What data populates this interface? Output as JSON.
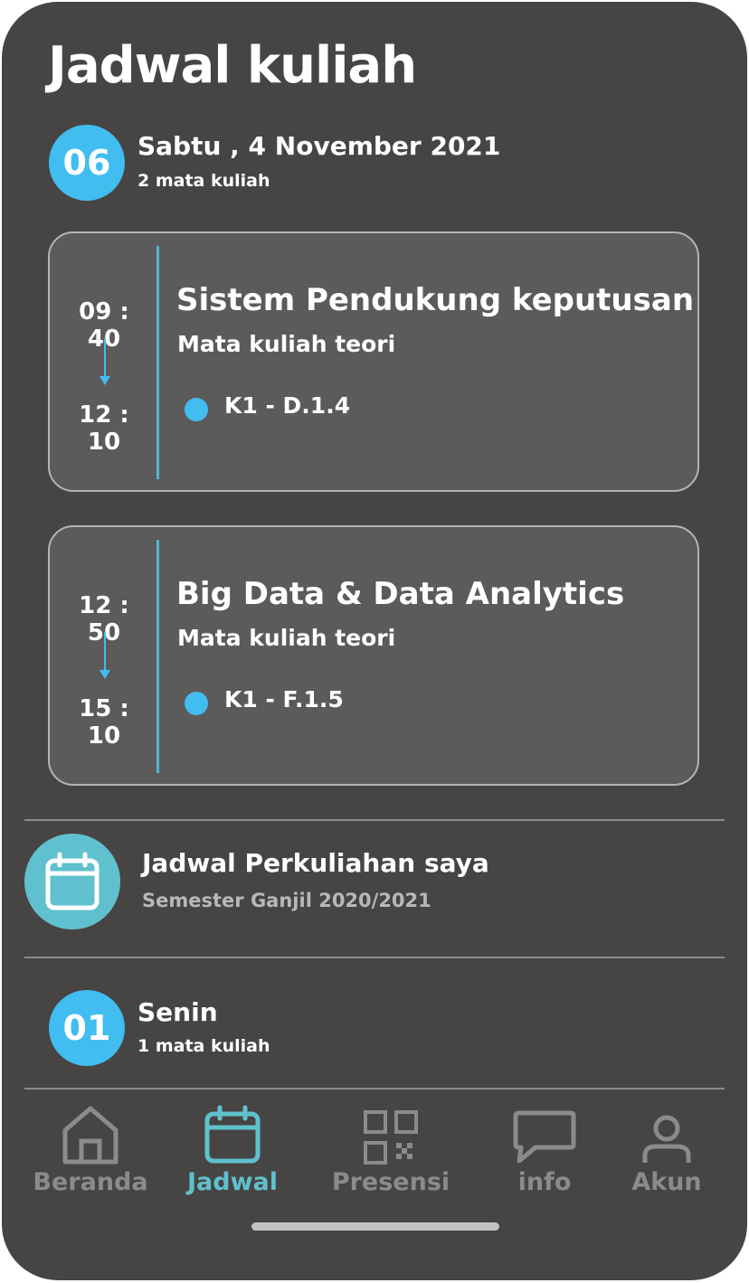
{
  "header": {
    "title": "Jadwal kuliah"
  },
  "today": {
    "day_number": "06",
    "date_label": "Sabtu , 4 November 2021",
    "count_label": "2 mata kuliah",
    "courses": [
      {
        "start": "09 : 40",
        "end": "12 : 10",
        "name": "Sistem Pendukung keputusan",
        "type": "Mata kuliah teori",
        "room": "K1 - D.1.4"
      },
      {
        "start": "12 : 50",
        "end": "15 : 10",
        "name": "Big Data & Data Analytics",
        "type": "Mata kuliah teori",
        "room": "K1 - F.1.5"
      }
    ]
  },
  "schedule": {
    "title": "Jadwal Perkuliahan saya",
    "subtitle": "Semester Ganjil 2020/2021",
    "icon": "calendar-icon"
  },
  "next_day": {
    "day_number": "01",
    "day_label": "Senin",
    "count_label": "1 mata kuliah"
  },
  "nav": [
    {
      "label": "Beranda",
      "icon": "home-icon",
      "active": false
    },
    {
      "label": "Jadwal",
      "icon": "calendar-icon",
      "active": true
    },
    {
      "label": "Presensi",
      "icon": "qr-code-icon",
      "active": false
    },
    {
      "label": "info",
      "icon": "chat-icon",
      "active": false
    },
    {
      "label": "Akun",
      "icon": "user-icon",
      "active": false
    }
  ],
  "colors": {
    "background": "#474444",
    "card": "#5c5a5b",
    "accent_blue": "#41bdf0",
    "accent_teal": "#5fc1cd",
    "inactive": "#8d8a8a"
  }
}
